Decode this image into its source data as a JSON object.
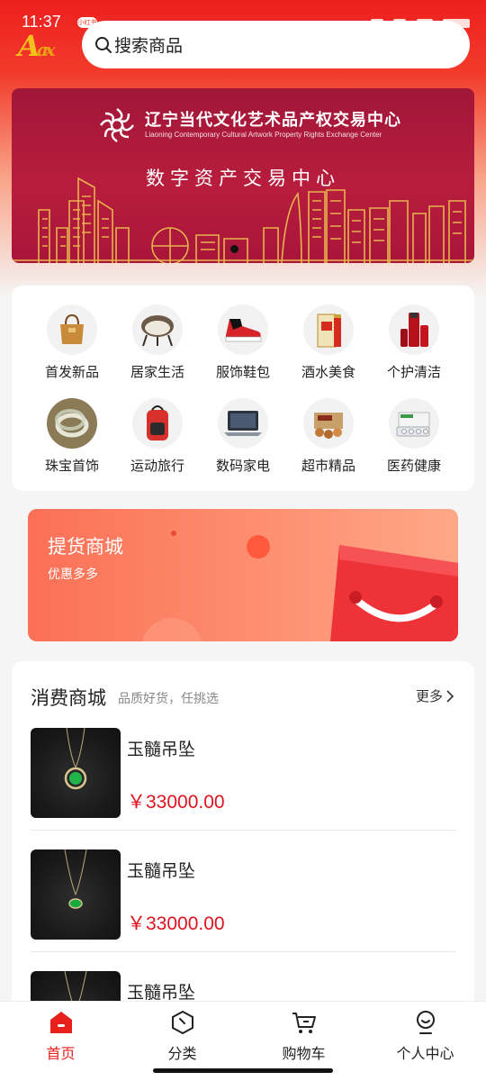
{
  "status_bar": {
    "time": "11:37",
    "pill_label": "小红书"
  },
  "header": {
    "logo_text": "A",
    "logo_suffix": "ax",
    "search_placeholder": "搜索商品"
  },
  "banner": {
    "title": "辽宁当代文化艺术品产权交易中心",
    "subtitle": "Liaoning Contemporary Cultural Artwork Property Rights Exchange Center",
    "slogan": "数字资产交易中心",
    "carousel_dots": 1,
    "colors": {
      "bg": "#b81d3d",
      "line": "#e7b34d"
    }
  },
  "categories": [
    {
      "label": "首发新品",
      "icon": "handbag-icon"
    },
    {
      "label": "居家生活",
      "icon": "chair-icon"
    },
    {
      "label": "服饰鞋包",
      "icon": "sneaker-icon"
    },
    {
      "label": "酒水美食",
      "icon": "liquor-icon"
    },
    {
      "label": "个护清洁",
      "icon": "skincare-icon"
    },
    {
      "label": "珠宝首饰",
      "icon": "bangle-icon"
    },
    {
      "label": "运动旅行",
      "icon": "backpack-icon"
    },
    {
      "label": "数码家电",
      "icon": "laptop-icon"
    },
    {
      "label": "超市精品",
      "icon": "snack-icon"
    },
    {
      "label": "医药健康",
      "icon": "medicine-icon"
    }
  ],
  "promo": {
    "title": "提货商城",
    "subtitle": "优惠多多"
  },
  "mall": {
    "title": "消费商城",
    "subtitle": "品质好货，任挑选",
    "more": "更多",
    "products": [
      {
        "name": "玉髓吊坠",
        "price": "￥33000.00"
      },
      {
        "name": "玉髓吊坠",
        "price": "￥33000.00"
      },
      {
        "name": "玉髓吊坠",
        "price": ""
      }
    ]
  },
  "tabbar": [
    {
      "label": "首页",
      "icon": "home-icon",
      "active": true
    },
    {
      "label": "分类",
      "icon": "category-icon",
      "active": false
    },
    {
      "label": "购物车",
      "icon": "cart-icon",
      "active": false
    },
    {
      "label": "个人中心",
      "icon": "profile-icon",
      "active": false
    }
  ],
  "colors": {
    "accent": "#e8201c",
    "price": "#e0131e",
    "header_red": "#ee1f1f"
  }
}
